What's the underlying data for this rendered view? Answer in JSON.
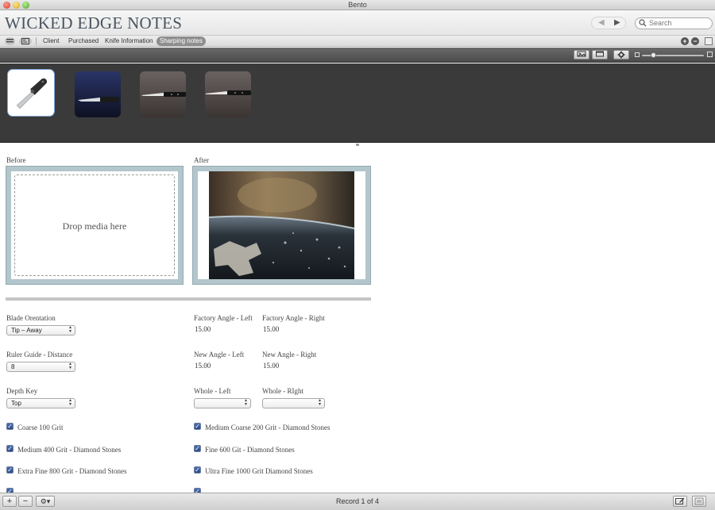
{
  "window": {
    "title": "Bento"
  },
  "header": {
    "database_title": "WICKED EDGE NOTES",
    "search": {
      "placeholder": "Search",
      "value": ""
    }
  },
  "viewbar": {
    "tabs": [
      {
        "label": "Client",
        "active": false
      },
      {
        "label": "Purchased",
        "active": false
      },
      {
        "label": "Knife Information",
        "active": false
      },
      {
        "label": "Sharping notes",
        "active": true
      }
    ]
  },
  "gallery": {
    "thumbnails": [
      {
        "name": "folding-knife",
        "selected": true
      },
      {
        "name": "knife-on-blue",
        "selected": false
      },
      {
        "name": "knife-on-brown",
        "selected": false
      },
      {
        "name": "knife-on-brown-2",
        "selected": false
      }
    ]
  },
  "form": {
    "before": {
      "label": "Before",
      "drop_text": "Drop media here"
    },
    "after": {
      "label": "After"
    },
    "fields": {
      "blade_orientation": {
        "label": "Blade Orentation",
        "value": "Tip – Away"
      },
      "ruler_guide": {
        "label": "Ruler Guide - Distance",
        "value": "8"
      },
      "depth_key": {
        "label": "Depth Key",
        "value": "Top"
      },
      "factory_left": {
        "label": "Factory Angle - Left",
        "value": "15.00"
      },
      "factory_right": {
        "label": "Factory Angle - Right",
        "value": "15.00"
      },
      "new_left": {
        "label": "New Angle - Left",
        "value": "15.00"
      },
      "new_right": {
        "label": "New Angle - Right",
        "value": "15.00"
      },
      "whole_left": {
        "label": "Whole - Left",
        "value": ""
      },
      "whole_right": {
        "label": "Whole - RIght",
        "value": ""
      }
    },
    "checkboxes": {
      "coarse_100": {
        "label": "Coarse 100 Grit",
        "checked": true
      },
      "medium_coarse_200": {
        "label": "Medium Coarse 200 Grit - Diamond Stones",
        "checked": true
      },
      "medium_400": {
        "label": "Medium 400 Grit - Diamond Stones",
        "checked": true
      },
      "fine_600": {
        "label": "Fine 600 Git - Diamond Stones",
        "checked": true
      },
      "extra_fine_800": {
        "label": "Extra Fine 800 Grit - Diamond Stones",
        "checked": true
      },
      "ultra_fine_1000": {
        "label": "Ultra Fine 1000 Grit Diamond Stones",
        "checked": true
      }
    }
  },
  "statusbar": {
    "record_text": "Record 1 of 4"
  },
  "colors": {
    "accent": "#2a4a88",
    "frame": "#b2c6cc",
    "gallery_bg": "#3a3a3a",
    "title": "#4a5560"
  }
}
